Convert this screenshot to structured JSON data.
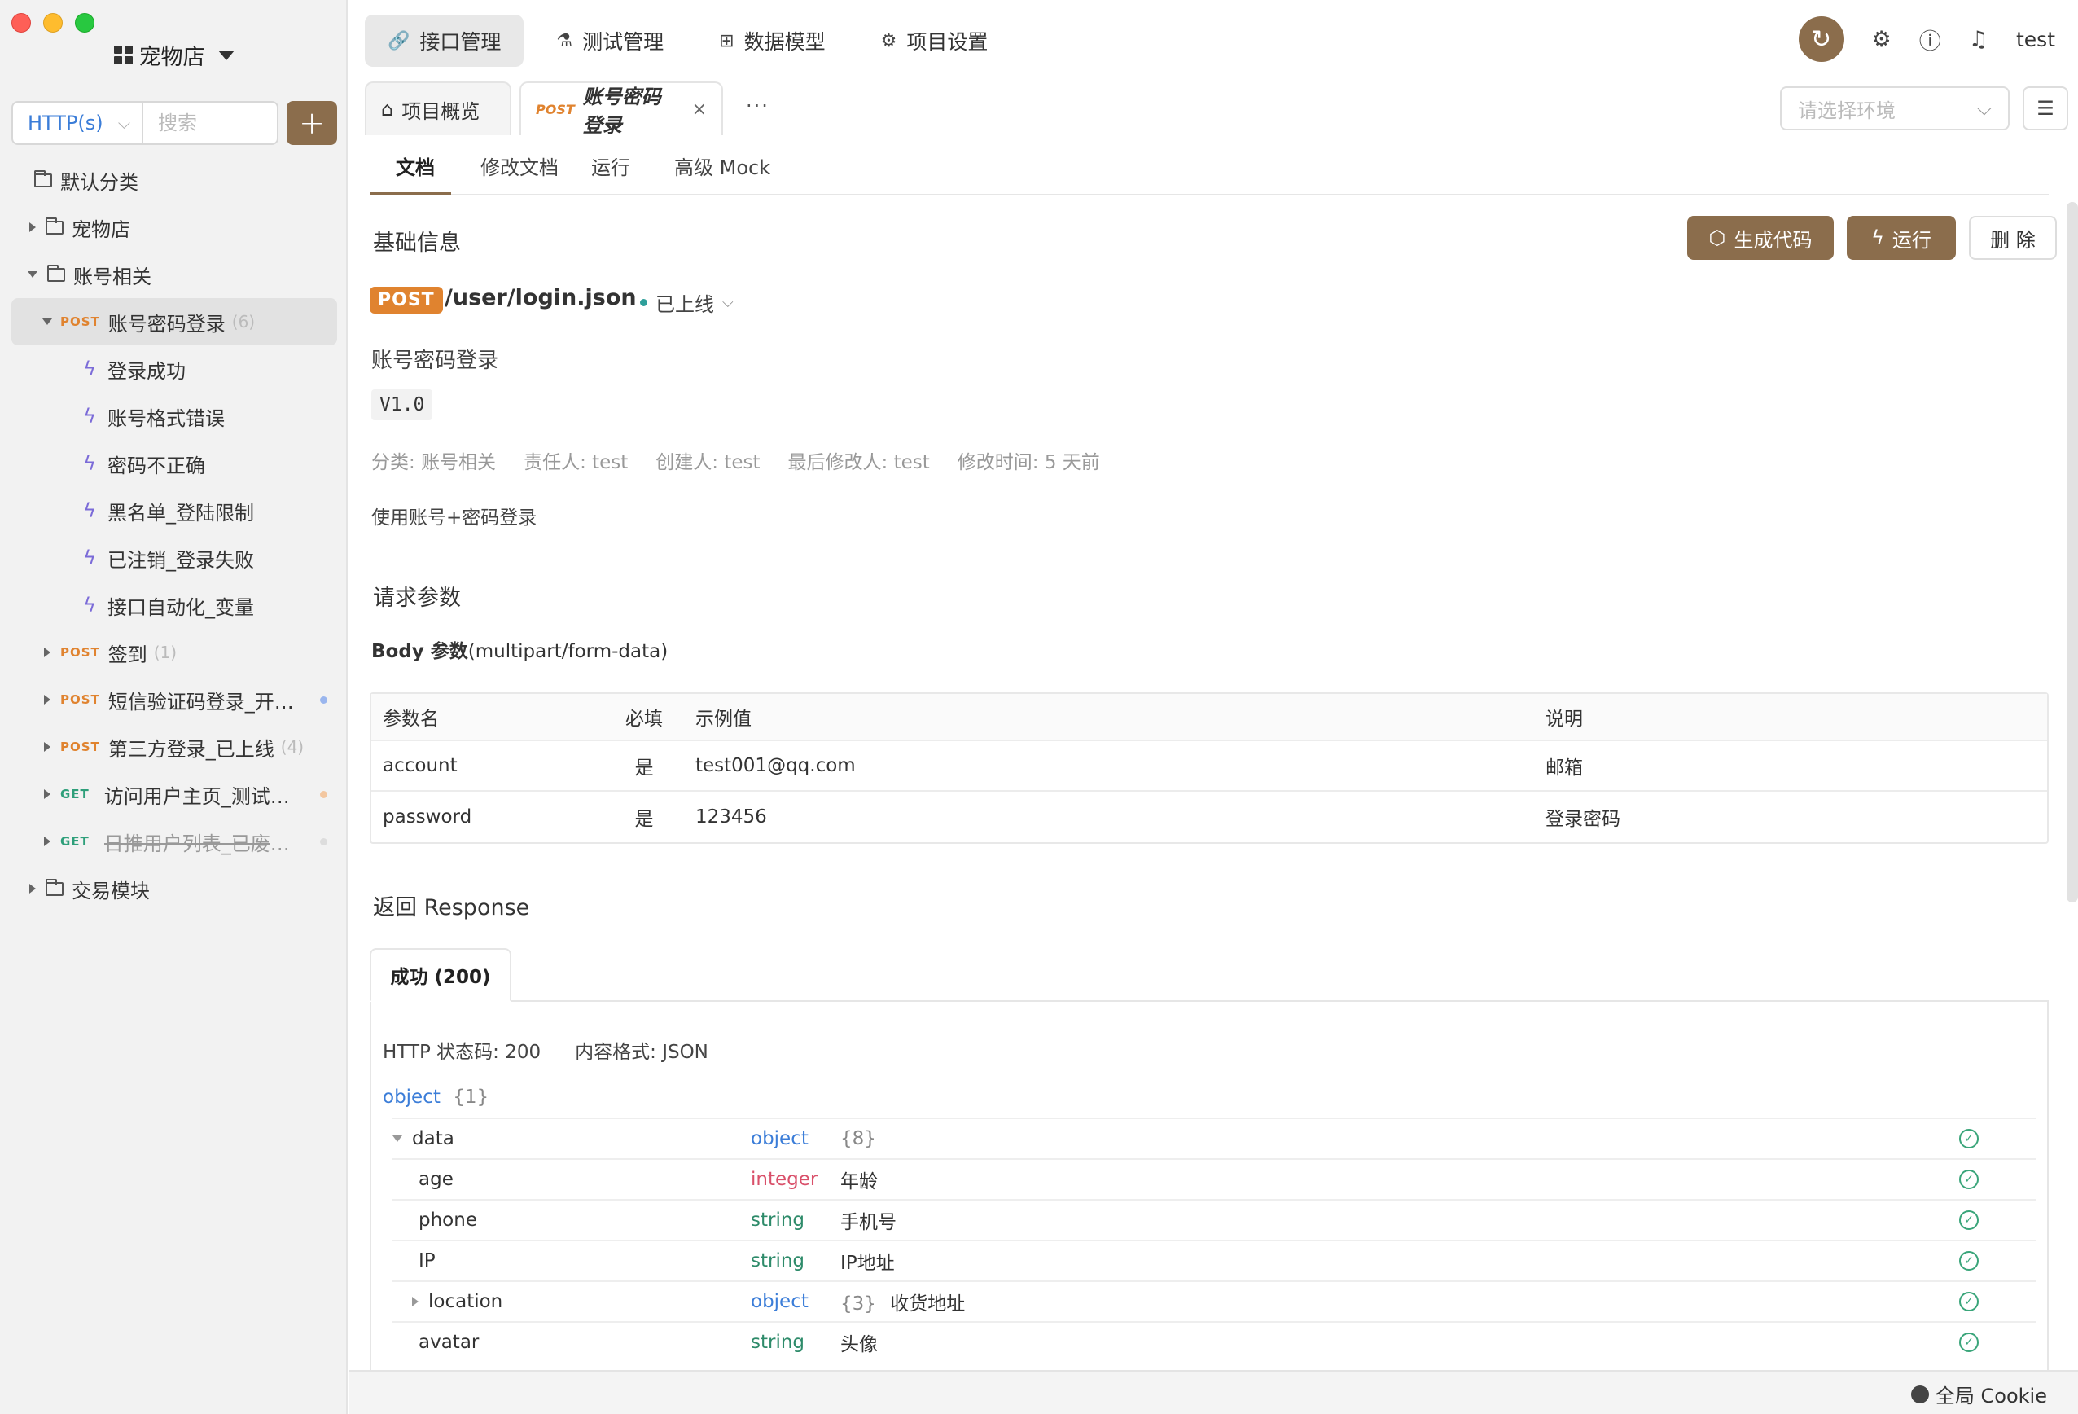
{
  "sidebar": {
    "project_name": "宠物店",
    "protocol": "HTTP(s)",
    "search_placeholder": "搜索",
    "add_label": "+",
    "tree": [
      {
        "label": "默认分类"
      },
      {
        "label": "宠物店"
      },
      {
        "label": "账号相关"
      },
      {
        "method": "POST",
        "label": "账号密码登录",
        "count": "(6)"
      },
      {
        "label": "登录成功"
      },
      {
        "label": "账号格式错误"
      },
      {
        "label": "密码不正确"
      },
      {
        "label": "黑名单_登陆限制"
      },
      {
        "label": "已注销_登录失败"
      },
      {
        "label": "接口自动化_变量"
      },
      {
        "method": "POST",
        "label": "签到",
        "count": "(1)"
      },
      {
        "method": "POST",
        "label": "短信验证码登录_开发..."
      },
      {
        "method": "POST",
        "label": "第三方登录_已上线",
        "count": "(4)"
      },
      {
        "method": "GET",
        "label": "访问用户主页_测试中..."
      },
      {
        "method": "GET",
        "label": "日推用户列表_已废弃..."
      },
      {
        "label": "交易模块"
      }
    ]
  },
  "topnav": {
    "items": [
      "接口管理",
      "测试管理",
      "数据模型",
      "项目设置"
    ],
    "user": "test"
  },
  "tabs": {
    "overview": "项目概览",
    "active_method": "POST",
    "active_title": "账号密码登录",
    "more": "···",
    "env_placeholder": "请选择环境"
  },
  "subtabs": [
    "文档",
    "修改文档",
    "运行",
    "高级 Mock"
  ],
  "doc": {
    "section_basic": "基础信息",
    "btn_codegen": "生成代码",
    "btn_run": "运行",
    "btn_delete": "删 除",
    "method": "POST",
    "path": "/user/login.json",
    "status": "已上线",
    "name": "账号密码登录",
    "version": "V1.0",
    "meta": [
      "分类: 账号相关",
      "责任人: test",
      "创建人: test",
      "最后修改人: test",
      "修改时间: 5 天前"
    ],
    "description": "使用账号+密码登录",
    "section_request": "请求参数",
    "body_label": "Body 参数",
    "body_type": "(multipart/form-data)",
    "params_headers": [
      "参数名",
      "必填",
      "示例值",
      "说明"
    ],
    "params": [
      [
        "account",
        "是",
        "test001@qq.com",
        "邮箱"
      ],
      [
        "password",
        "是",
        "123456",
        "登录密码"
      ]
    ],
    "section_response": "返回 Response",
    "resp_tab": "成功 (200)",
    "resp_status": "HTTP 状态码: 200",
    "resp_format": "内容格式: JSON",
    "root_type": "object",
    "root_count": "{1}",
    "schema": [
      {
        "name": "data",
        "type": "object",
        "extra": "{8}",
        "desc": ""
      },
      {
        "name": "age",
        "type": "integer",
        "extra": "",
        "desc": "年龄"
      },
      {
        "name": "phone",
        "type": "string",
        "extra": "",
        "desc": "手机号"
      },
      {
        "name": "IP",
        "type": "string",
        "extra": "",
        "desc": "IP地址"
      },
      {
        "name": "location",
        "type": "object",
        "extra": "{3}",
        "desc": "收货地址"
      },
      {
        "name": "avatar",
        "type": "string",
        "extra": "",
        "desc": "头像"
      }
    ]
  },
  "footer": {
    "cookie": "全局 Cookie"
  },
  "colors": {
    "brand": "#8b6d4c",
    "post": "#e0832f",
    "get": "#2e9f7a"
  }
}
